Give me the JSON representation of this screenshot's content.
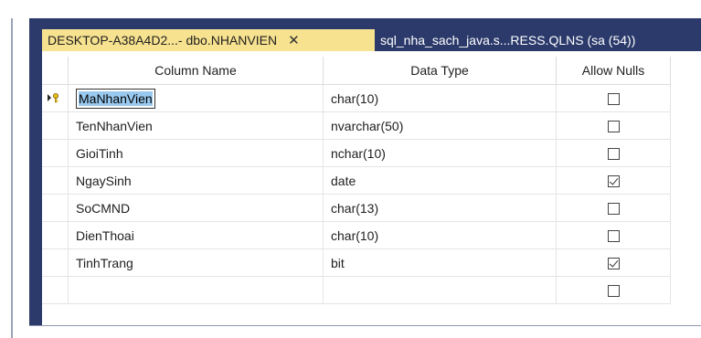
{
  "tabs": [
    {
      "label": "DESKTOP-A38A4D2...- dbo.NHANVIEN",
      "close": "✕",
      "active": true
    },
    {
      "label": "sql_nha_sach_java.s...RESS.QLNS (sa (54))",
      "active": false
    }
  ],
  "grid": {
    "headers": {
      "name": "Column Name",
      "type": "Data Type",
      "nulls": "Allow Nulls"
    },
    "rows": [
      {
        "name": "MaNhanVien",
        "type": "char(10)",
        "allow_nulls": false,
        "selected": true,
        "key": true
      },
      {
        "name": "TenNhanVien",
        "type": "nvarchar(50)",
        "allow_nulls": false
      },
      {
        "name": "GioiTinh",
        "type": "nchar(10)",
        "allow_nulls": false
      },
      {
        "name": "NgaySinh",
        "type": "date",
        "allow_nulls": true
      },
      {
        "name": "SoCMND",
        "type": "char(13)",
        "allow_nulls": false
      },
      {
        "name": "DienThoai",
        "type": "char(10)",
        "allow_nulls": false
      },
      {
        "name": "TinhTrang",
        "type": "bit",
        "allow_nulls": true
      },
      {
        "name": "",
        "type": "",
        "allow_nulls": false
      }
    ]
  },
  "colors": {
    "tabstrip": "#2b3a6b",
    "active_tab": "#f7e28f",
    "selection": "#99c9ef"
  }
}
